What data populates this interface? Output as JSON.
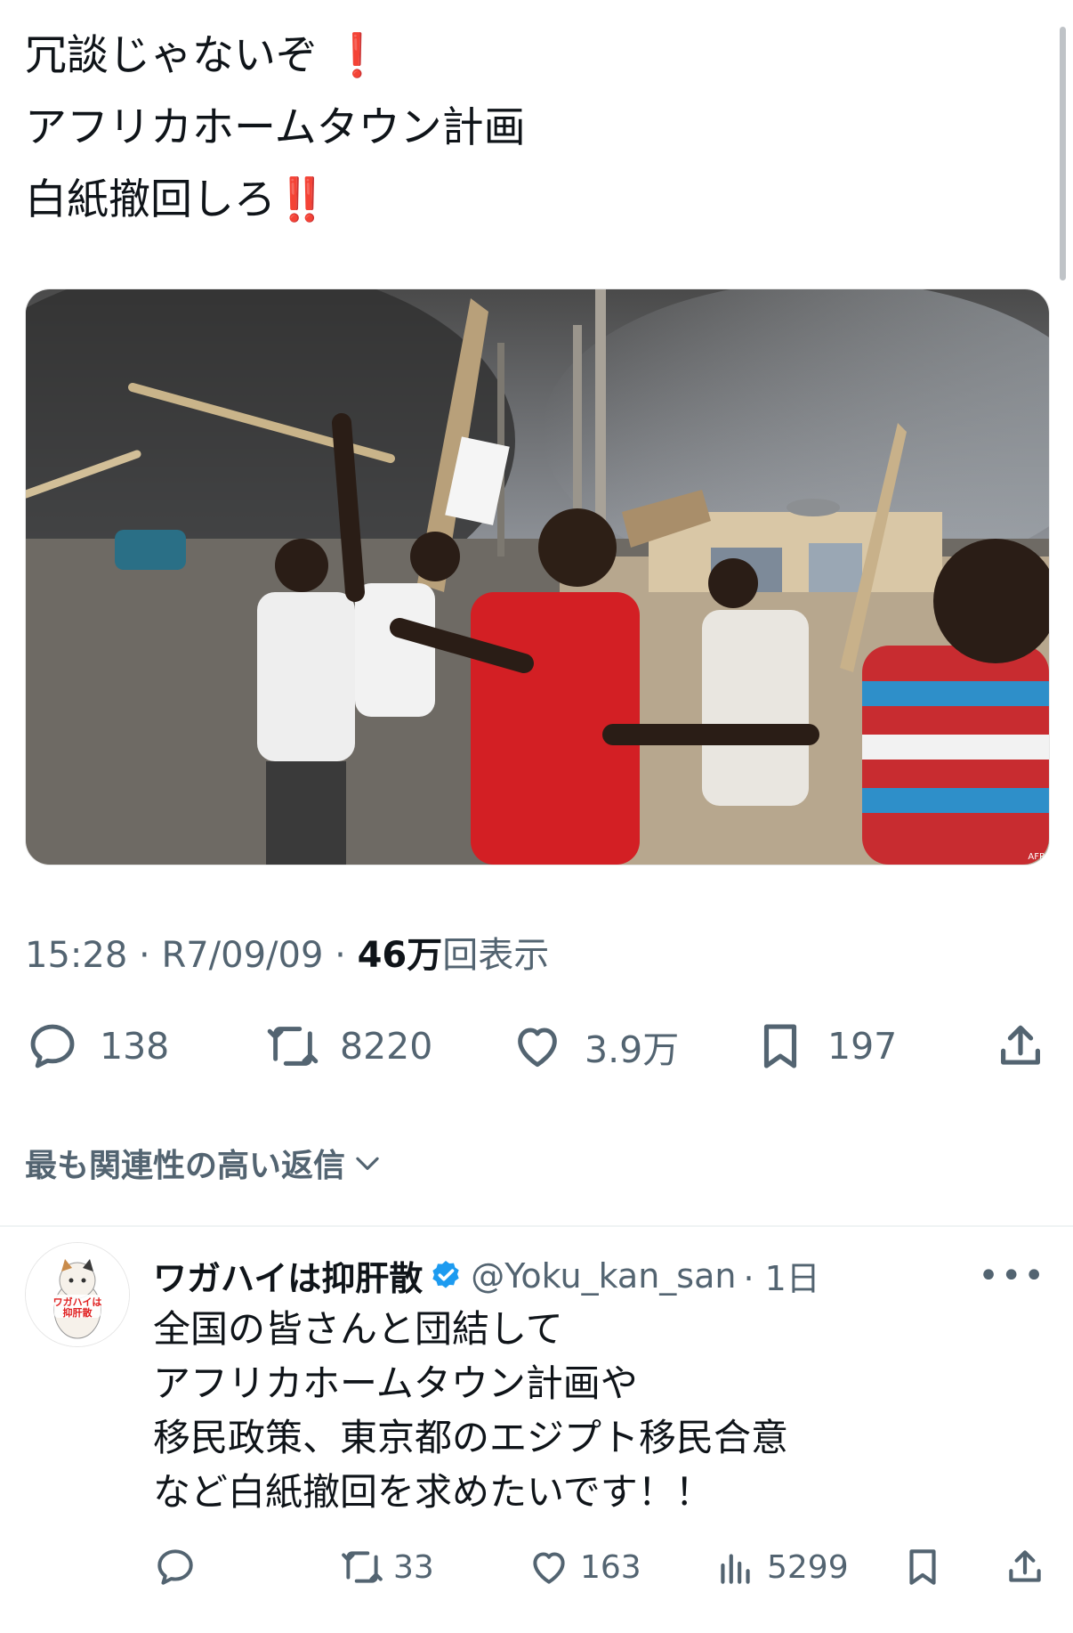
{
  "post": {
    "lines": [
      "冗談じゃないぞ",
      "アフリカホームタウン計画",
      "白紙撤回しろ"
    ],
    "emoji_1": "❗",
    "emoji_2": "‼️",
    "time": "15:28",
    "date": "R7/09/09",
    "views_count": "46万",
    "views_label": "回表示",
    "stats": {
      "replies": "138",
      "reposts": "8220",
      "likes": "3.9万",
      "bookmarks": "197"
    }
  },
  "image": {
    "watermark": "AFP"
  },
  "sort": {
    "label": "最も関連性の高い返信"
  },
  "reply": {
    "name": "ワガハイは抑肝散",
    "handle": "@Yoku_kan_san",
    "time": "· 1日",
    "lines": [
      "全国の皆さんと団結して",
      "アフリカホームタウン計画や",
      "移民政策、東京都のエジプト移民合意",
      "など白紙撤回を求めたいです！！"
    ],
    "stats": {
      "reposts": "33",
      "likes": "163",
      "views": "5299"
    },
    "avatar_text": "ワガハイは抑肝散"
  },
  "colors": {
    "text": "#0f1419",
    "secondary": "#536471",
    "verified": "#1d9bf0",
    "emoji_red": "#e3122a"
  },
  "icons": [
    "reply-icon",
    "repost-icon",
    "like-icon",
    "bookmark-icon",
    "share-icon",
    "views-icon",
    "verified-badge-icon",
    "more-icon",
    "chevron-down-icon"
  ]
}
